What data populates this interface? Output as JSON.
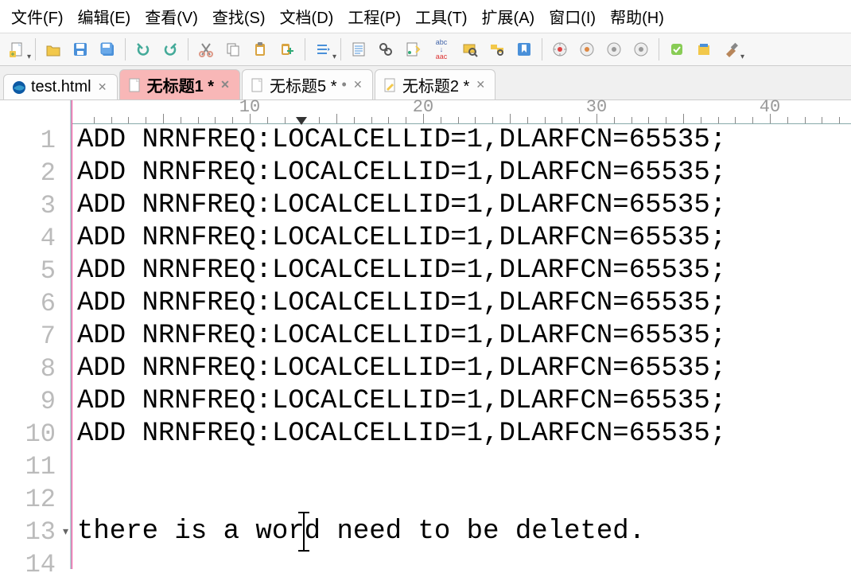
{
  "menubar": [
    "文件(F)",
    "编辑(E)",
    "查看(V)",
    "查找(S)",
    "文档(D)",
    "工程(P)",
    "工具(T)",
    "扩展(A)",
    "窗口(I)",
    "帮助(H)"
  ],
  "toolbar": {
    "new": "new-file",
    "open": "open",
    "save": "save",
    "saveall": "save-all",
    "undo": "undo",
    "redo": "redo",
    "cut": "cut",
    "copy": "copy",
    "paste": "paste",
    "pasteappend": "paste-append",
    "props": "doc-props",
    "find": "find",
    "findrepl": "find-replace",
    "mark": "highlight",
    "replace_text": "abc",
    "replace_text2": "aac",
    "searchdoc": "search-doc",
    "searchproj": "search-proj",
    "bookmark": "bookmark",
    "run1": "run",
    "run2": "run2",
    "run3": "run3",
    "run4": "run4",
    "grp1": "grp",
    "grp2": "docs",
    "build": "build"
  },
  "tabs": [
    {
      "label": "test.html",
      "dirty": false,
      "icon": "edge"
    },
    {
      "label": "无标题1 *",
      "dirty": true,
      "icon": "file",
      "active": true
    },
    {
      "label": "无标题5 *",
      "dirty": true,
      "icon": "file"
    },
    {
      "label": "无标题2 *",
      "dirty": true,
      "icon": "pencil"
    }
  ],
  "ruler": {
    "marks": [
      10,
      20,
      30,
      40
    ],
    "caret_col": 13
  },
  "editor": {
    "lines": [
      "ADD NRNFREQ:LOCALCELLID=1,DLARFCN=65535;",
      "ADD NRNFREQ:LOCALCELLID=1,DLARFCN=65535;",
      "ADD NRNFREQ:LOCALCELLID=1,DLARFCN=65535;",
      "ADD NRNFREQ:LOCALCELLID=1,DLARFCN=65535;",
      "ADD NRNFREQ:LOCALCELLID=1,DLARFCN=65535;",
      "ADD NRNFREQ:LOCALCELLID=1,DLARFCN=65535;",
      "ADD NRNFREQ:LOCALCELLID=1,DLARFCN=65535;",
      "ADD NRNFREQ:LOCALCELLID=1,DLARFCN=65535;",
      "ADD NRNFREQ:LOCALCELLID=1,DLARFCN=65535;",
      "ADD NRNFREQ:LOCALCELLID=1,DLARFCN=65535;",
      "",
      "",
      "there is a word need to be deleted.",
      ""
    ],
    "cursor": {
      "line": 13,
      "col": 15
    }
  }
}
